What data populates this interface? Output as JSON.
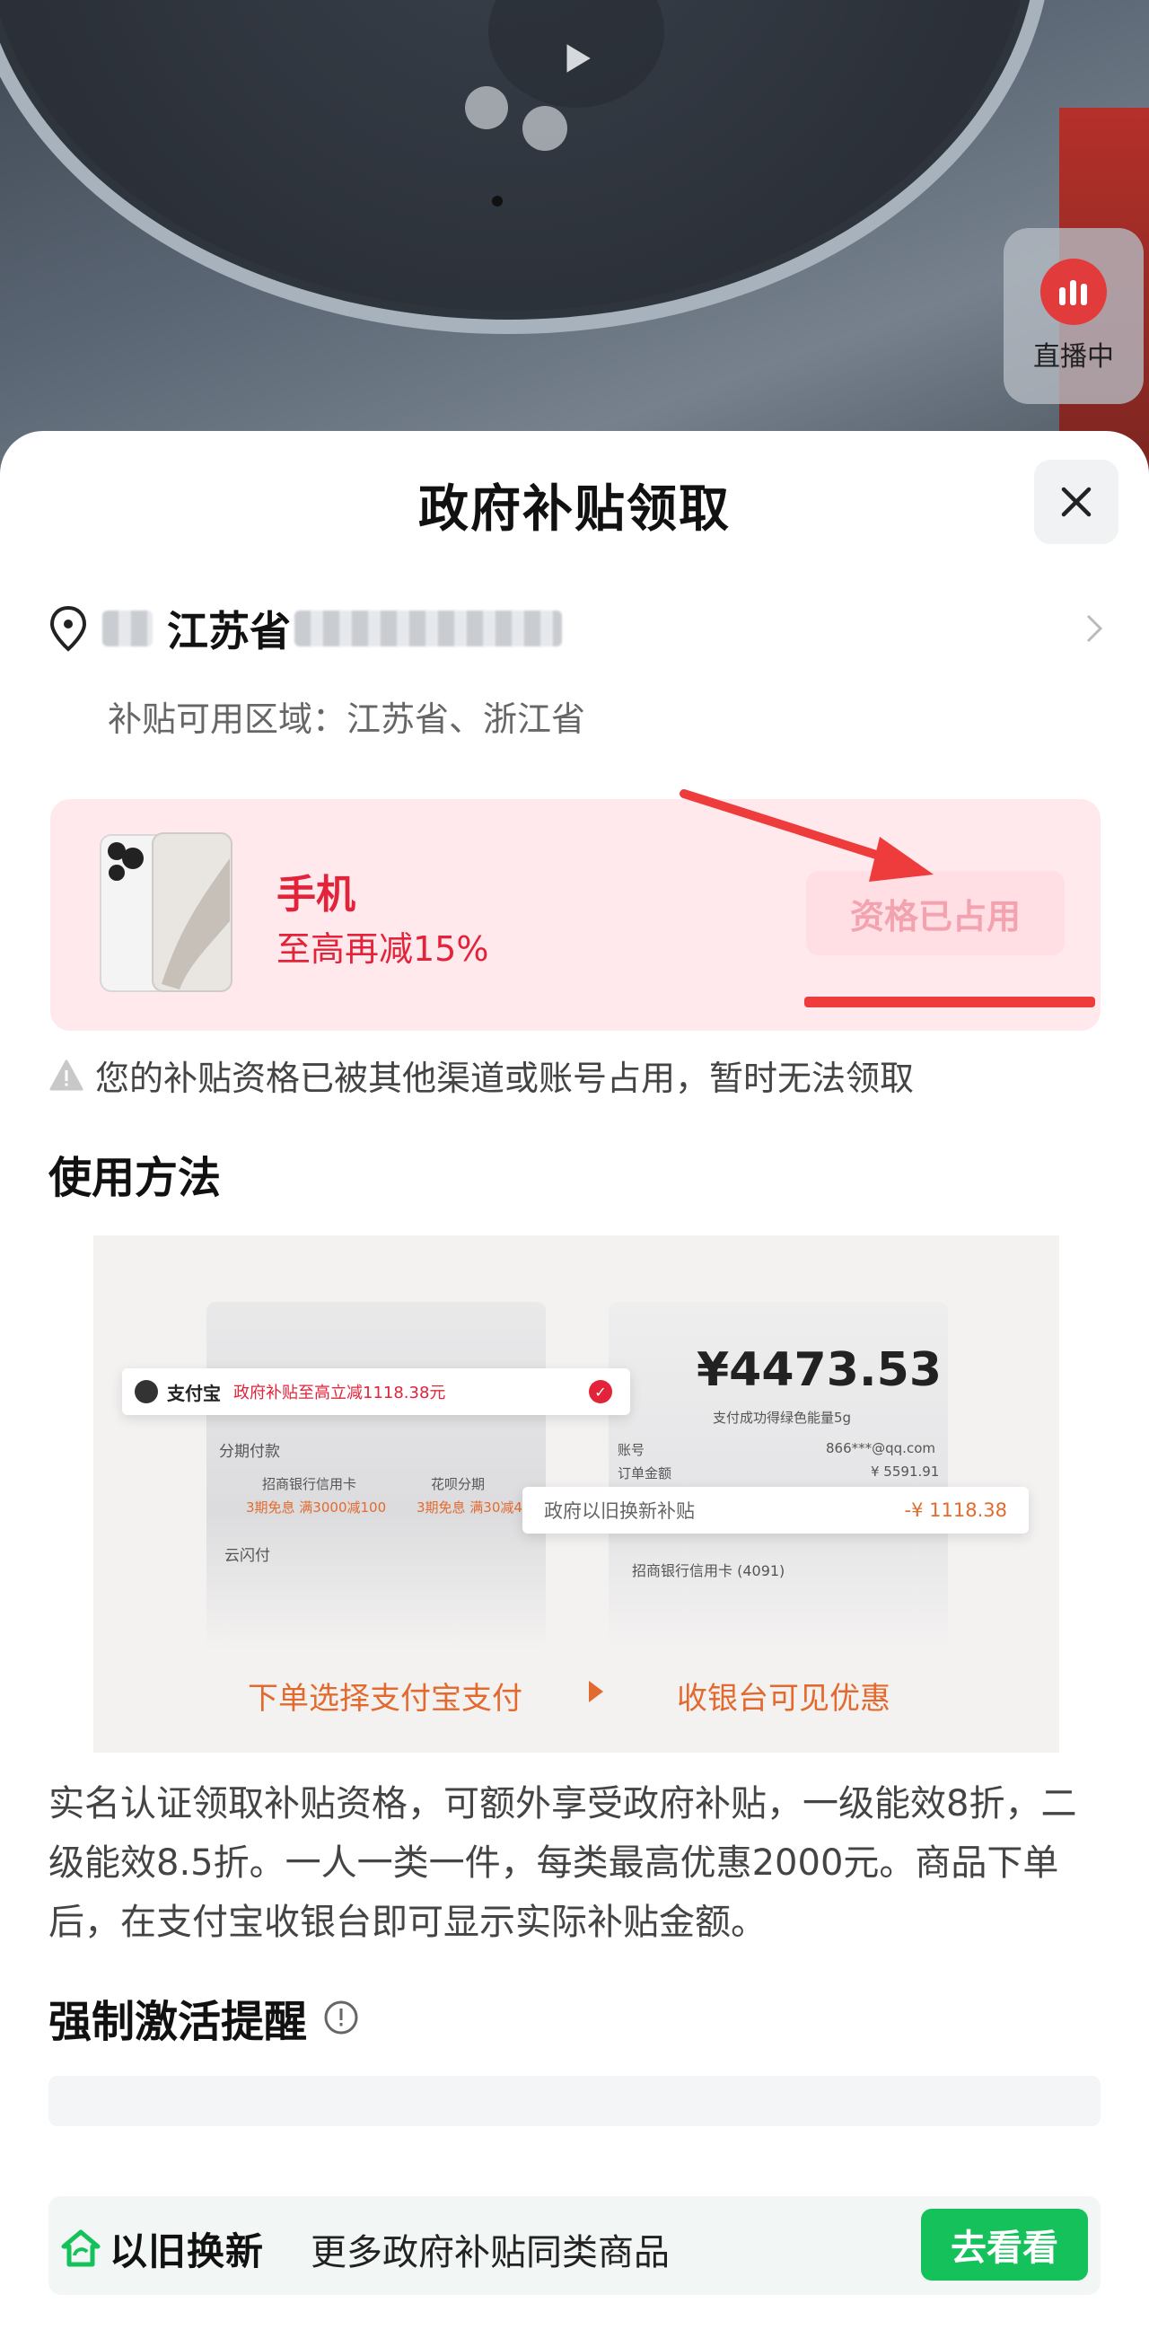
{
  "live": {
    "label": "直播中"
  },
  "sheet": {
    "title": "政府补贴领取",
    "address": {
      "province": "江苏省",
      "available_area": "补贴可用区域：江苏省、浙江省"
    },
    "subsidy_card": {
      "category": "手机",
      "discount": "至高再减15%",
      "button_label": "资格已占用"
    },
    "warning": "您的补贴资格已被其他渠道或账号占用，暂时无法领取",
    "usage": {
      "heading": "使用方法",
      "illustration": {
        "alipay_label": "支付宝",
        "alipay_promo": "政府补贴至高立减1118.38元",
        "installment_label": "分期付款",
        "cmb_label": "招商银行信用卡",
        "cmb_promo": "3期免息 满3000减100",
        "huabei_label": "花呗分期",
        "huabei_promo": "3期免息 满30减4",
        "cloudpay_label": "云闪付",
        "amount": "¥4473.53",
        "energy_note": "支付成功得绿色能量5g",
        "account_label": "账号",
        "account_value": "866***@qq.com",
        "order_label": "订单金额",
        "order_value": "¥ 5591.91",
        "subsidy_label": "政府以旧换新补贴",
        "subsidy_value": "-¥ 1118.38",
        "card_label": "招商银行信用卡 (4091)",
        "step1": "下单选择支付宝支付",
        "step2": "收银台可见优惠"
      },
      "description": "实名认证领取补贴资格，可额外享受政府补贴，一级能效8折，二级能效8.5折。一人一类一件，每类最高优惠2000元。商品下单后，在支付宝收银台即可显示实际补贴金额。"
    },
    "reminder": {
      "heading": "强制激活提醒"
    },
    "bottom": {
      "logo_text": "以旧换新",
      "text": "更多政府补贴同类商品",
      "button_label": "去看看"
    }
  },
  "colors": {
    "accent_red": "#e2233a",
    "card_bg": "#ffe9ec",
    "green": "#14c15a",
    "orange": "#e36a2f"
  }
}
